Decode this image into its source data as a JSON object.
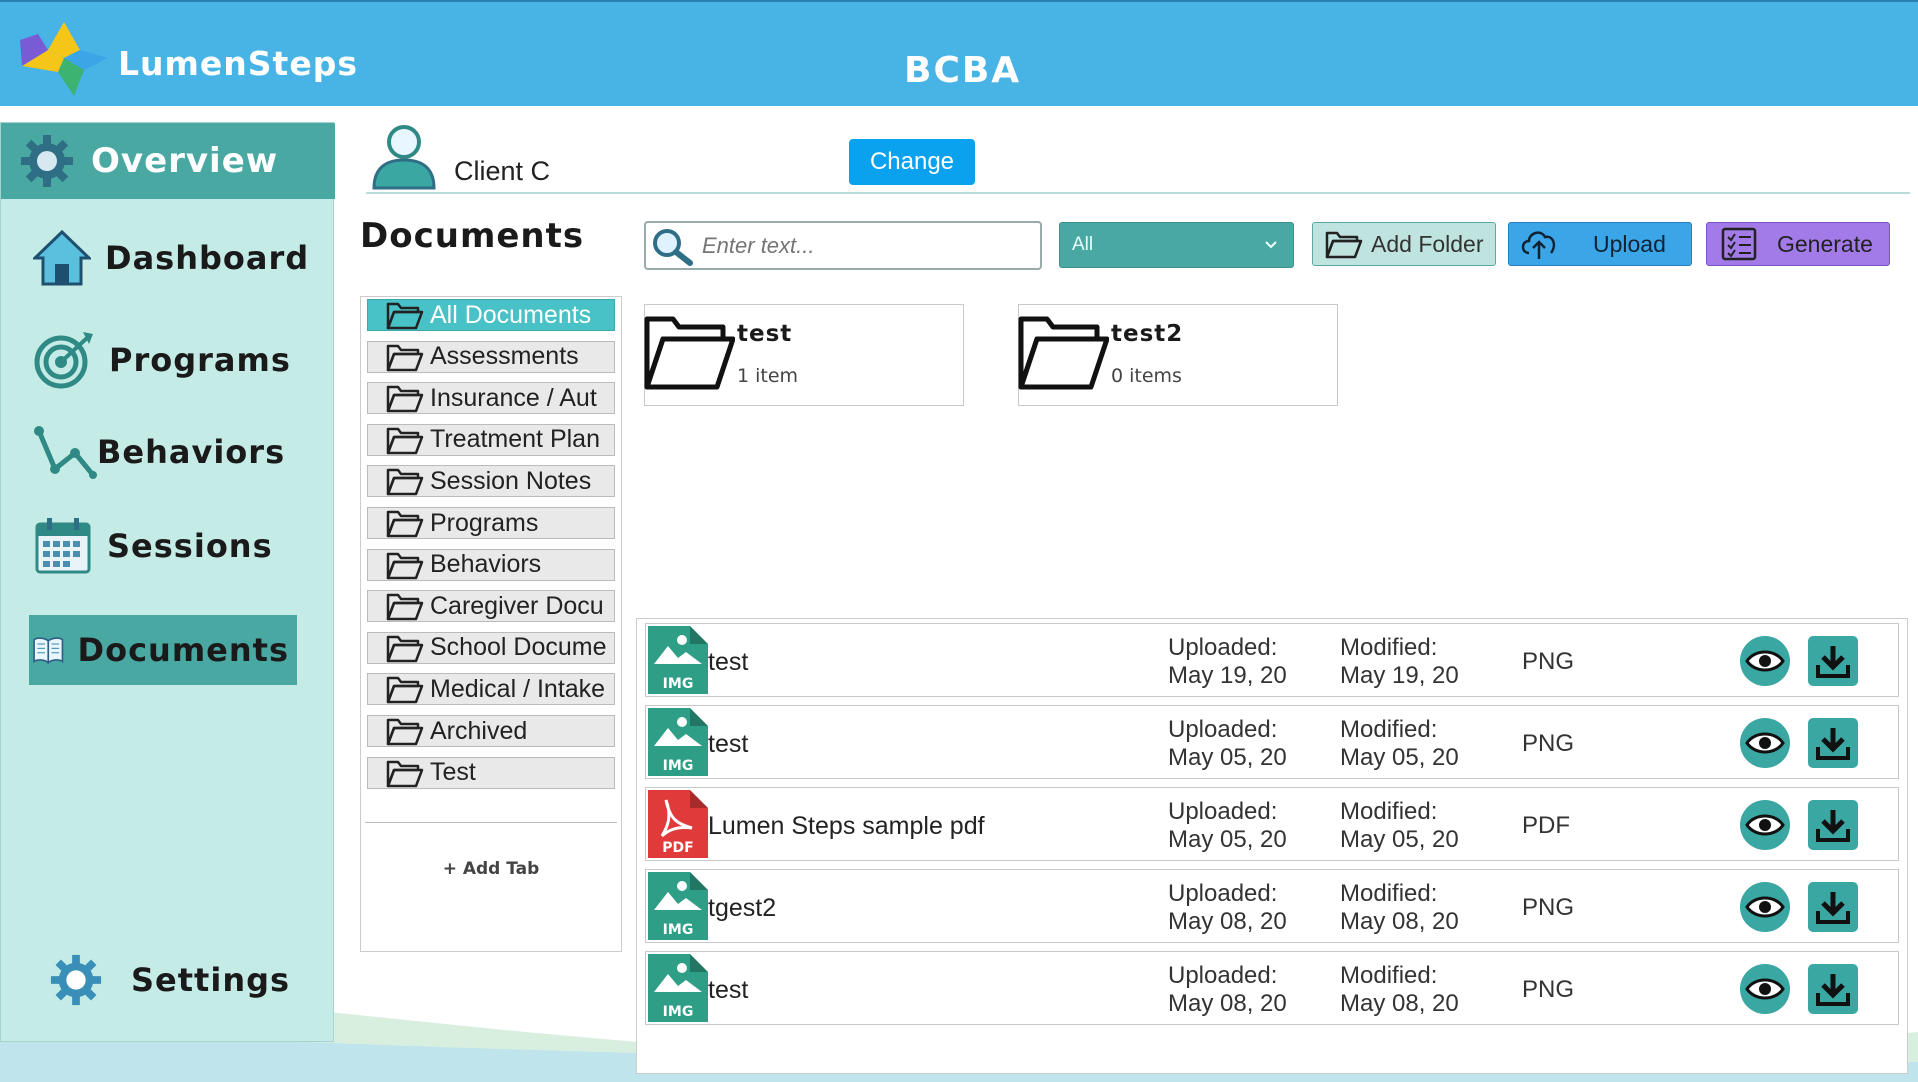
{
  "header": {
    "app_name": "LumenSteps",
    "role_title": "BCBA"
  },
  "sidebar": {
    "overview_label": "Overview",
    "items": [
      {
        "label": "Dashboard",
        "icon": "home-icon"
      },
      {
        "label": "Programs",
        "icon": "target-icon"
      },
      {
        "label": "Behaviors",
        "icon": "line-graph-icon"
      },
      {
        "label": "Sessions",
        "icon": "calendar-icon"
      },
      {
        "label": "Documents",
        "icon": "book-icon",
        "active": true
      }
    ],
    "settings_label": "Settings"
  },
  "client": {
    "name": "Client C",
    "change_label": "Change"
  },
  "documents": {
    "title": "Documents",
    "search_placeholder": "Enter text...",
    "filter_value": "All",
    "add_folder_label": "Add Folder",
    "upload_label": "Upload",
    "generate_label": "Generate"
  },
  "tabs": [
    {
      "label": "All Documents",
      "active": true
    },
    {
      "label": "Assessments"
    },
    {
      "label": "Insurance / Aut"
    },
    {
      "label": "Treatment Plan"
    },
    {
      "label": "Session Notes"
    },
    {
      "label": "Programs"
    },
    {
      "label": "Behaviors"
    },
    {
      "label": "Caregiver Docu"
    },
    {
      "label": "School Docume"
    },
    {
      "label": "Medical / Intake"
    },
    {
      "label": "Archived"
    },
    {
      "label": "Test"
    }
  ],
  "add_tab_label": "+ Add Tab",
  "folders": [
    {
      "name": "test",
      "count": "1 item"
    },
    {
      "name": "test2",
      "count": "0 items"
    }
  ],
  "files": [
    {
      "badge": "IMG",
      "name": "test",
      "uploaded_label": "Uploaded:",
      "uploaded": "May 19, 20",
      "modified_label": "Modified:",
      "modified": "May 19, 20",
      "type": "PNG"
    },
    {
      "badge": "IMG",
      "name": "test",
      "uploaded_label": "Uploaded:",
      "uploaded": "May 05, 20",
      "modified_label": "Modified:",
      "modified": "May 05, 20",
      "type": "PNG"
    },
    {
      "badge": "PDF",
      "name": "Lumen Steps sample pdf",
      "uploaded_label": "Uploaded:",
      "uploaded": "May 05, 20",
      "modified_label": "Modified:",
      "modified": "May 05, 20",
      "type": "PDF"
    },
    {
      "badge": "IMG",
      "name": "tgest2",
      "uploaded_label": "Uploaded:",
      "uploaded": "May 08, 20",
      "modified_label": "Modified:",
      "modified": "May 08, 20",
      "type": "PNG"
    },
    {
      "badge": "IMG",
      "name": "test",
      "uploaded_label": "Uploaded:",
      "uploaded": "May 08, 20",
      "modified_label": "Modified:",
      "modified": "May 08, 20",
      "type": "PNG"
    }
  ],
  "colors": {
    "header": "#48b4e6",
    "sidebar": "#c5ebe6",
    "accent_teal": "#4aa8a3",
    "change_button": "#0aa2ee",
    "upload_button": "#3aa6e8",
    "generate_button": "#a27be8",
    "img_badge": "#2e9e86",
    "pdf_badge": "#e03a3a"
  }
}
